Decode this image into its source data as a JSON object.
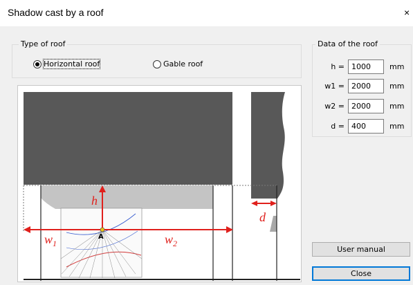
{
  "window": {
    "title": "Shadow cast by a roof",
    "close_glyph": "×"
  },
  "roof_type": {
    "label": "Type of roof",
    "options": [
      {
        "label": "Horizontal roof",
        "selected": true
      },
      {
        "label": "Gable roof",
        "selected": false
      }
    ]
  },
  "roof_data": {
    "label": "Data of the roof",
    "fields": [
      {
        "label": "h =",
        "value": "1000",
        "unit": "mm"
      },
      {
        "label": "w1 =",
        "value": "2000",
        "unit": "mm"
      },
      {
        "label": "w2 =",
        "value": "2000",
        "unit": "mm"
      },
      {
        "label": "d =",
        "value": "400",
        "unit": "mm"
      }
    ]
  },
  "diagram": {
    "h": "h",
    "w1": "w",
    "w1_sub": "1",
    "w2": "w",
    "w2_sub": "2",
    "d": "d",
    "point": "A"
  },
  "buttons": {
    "user_manual": "User manual",
    "close": "Close"
  },
  "colors": {
    "roof": "#585858",
    "shadow": "#c4c4c4",
    "dimension": "#e0201c",
    "focus": "#0078d7"
  }
}
